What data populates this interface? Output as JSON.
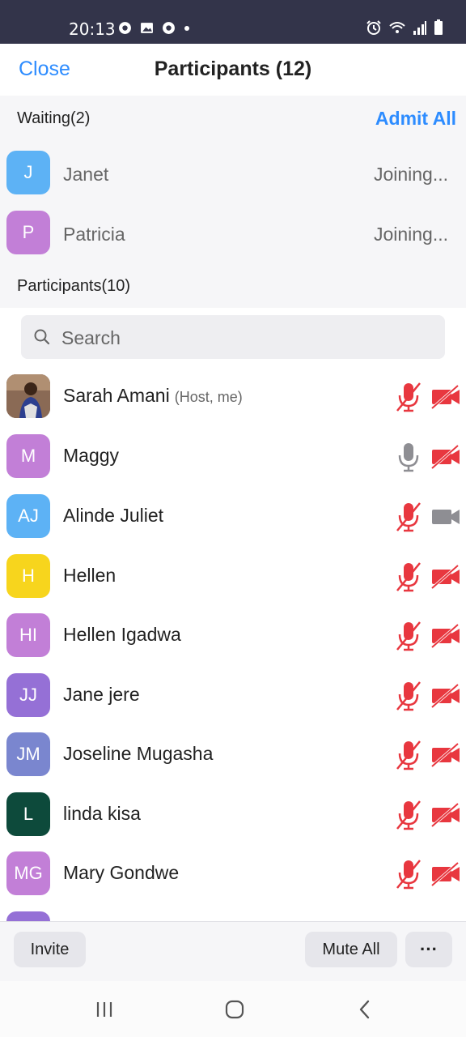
{
  "status_bar": {
    "time": "20:13",
    "left_icons": [
      "chrome-icon",
      "image-icon",
      "chrome-icon",
      "dot-icon"
    ],
    "right_icons": [
      "alarm-icon",
      "wifi-icon",
      "signal-icon",
      "battery-icon"
    ]
  },
  "header": {
    "close_label": "Close",
    "title": "Participants (12)"
  },
  "waiting": {
    "label": "Waiting(2)",
    "admit_all_label": "Admit All",
    "items": [
      {
        "initials": "J",
        "name": "Janet",
        "status": "Joining...",
        "color": "#5db2f5"
      },
      {
        "initials": "P",
        "name": "Patricia",
        "status": "Joining...",
        "color": "#c27fd7"
      }
    ]
  },
  "participants_label": "Participants(10)",
  "search": {
    "placeholder": "Search"
  },
  "participants": [
    {
      "initials": "",
      "name": "Sarah Amani",
      "role": "(Host, me)",
      "color": "#6b4a3a",
      "mic": "muted",
      "video": "off",
      "photo": true
    },
    {
      "initials": "M",
      "name": "Maggy",
      "role": "",
      "color": "#c27fd7",
      "mic": "on",
      "video": "off"
    },
    {
      "initials": "AJ",
      "name": "Alinde Juliet",
      "role": "",
      "color": "#5db2f5",
      "mic": "muted",
      "video": "on"
    },
    {
      "initials": "H",
      "name": "Hellen",
      "role": "",
      "color": "#f7d51d",
      "mic": "muted",
      "video": "off"
    },
    {
      "initials": "HI",
      "name": "Hellen Igadwa",
      "role": "",
      "color": "#c27fd7",
      "mic": "muted",
      "video": "off"
    },
    {
      "initials": "JJ",
      "name": "Jane jere",
      "role": "",
      "color": "#9570d6",
      "mic": "muted",
      "video": "off"
    },
    {
      "initials": "JM",
      "name": "Joseline Mugasha",
      "role": "",
      "color": "#7a86cf",
      "mic": "muted",
      "video": "off"
    },
    {
      "initials": "L",
      "name": "linda kisa",
      "role": "",
      "color": "#0d4a3b",
      "mic": "muted",
      "video": "off"
    },
    {
      "initials": "MG",
      "name": "Mary Gondwe",
      "role": "",
      "color": "#c27fd7",
      "mic": "muted",
      "video": "off"
    }
  ],
  "footer": {
    "invite_label": "Invite",
    "mute_all_label": "Mute All",
    "more_label": "···"
  },
  "nav": {
    "recents_icon": "recents-icon",
    "home_icon": "home-icon",
    "back_icon": "back-icon"
  },
  "colors": {
    "accent": "#2d8cff",
    "muted_red": "#e8373f",
    "status_bar": "#33344a"
  }
}
